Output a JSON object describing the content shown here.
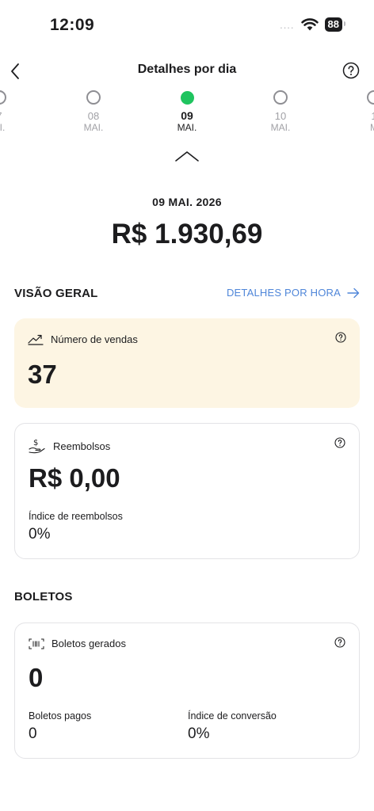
{
  "status_bar": {
    "time": "12:09",
    "signal": "....",
    "battery": "88"
  },
  "nav": {
    "title": "Detalhes por dia"
  },
  "days": [
    {
      "num": "7",
      "month": "AI.",
      "selected": false
    },
    {
      "num": "08",
      "month": "MAI.",
      "selected": false
    },
    {
      "num": "09",
      "month": "MAI.",
      "selected": true
    },
    {
      "num": "10",
      "month": "MAI.",
      "selected": false
    },
    {
      "num": "1",
      "month": "M",
      "selected": false
    }
  ],
  "summary": {
    "date": "09 MAI. 2026",
    "total": "R$ 1.930,69"
  },
  "overview": {
    "title": "VISÃO GERAL",
    "hour_link": "DETALHES POR HORA",
    "sales": {
      "label": "Número de vendas",
      "value": "37"
    },
    "refunds": {
      "label": "Reembolsos",
      "value": "R$ 0,00",
      "index_label": "Índice de reembolsos",
      "index_value": "0%"
    }
  },
  "boletos": {
    "title": "BOLETOS",
    "generated_label": "Boletos gerados",
    "generated_value": "0",
    "paid_label": "Boletos pagos",
    "paid_value": "0",
    "conversion_label": "Índice de conversão",
    "conversion_value": "0%"
  },
  "colors": {
    "accent_green": "#1fc45f",
    "link_blue": "#4f86d9",
    "sales_card_bg": "#fdf5e3"
  }
}
